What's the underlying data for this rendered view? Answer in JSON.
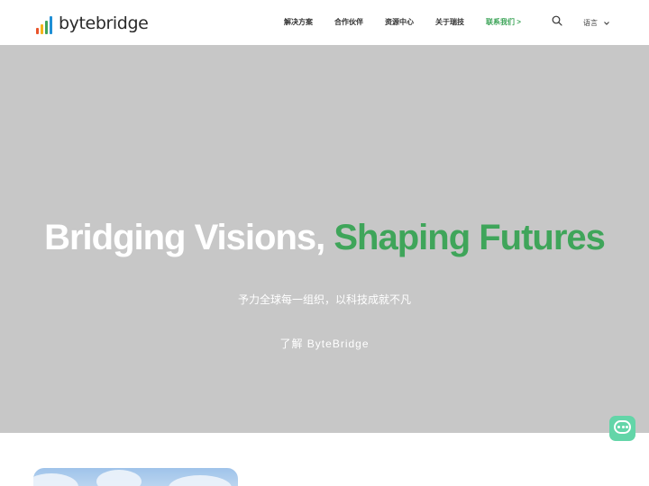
{
  "header": {
    "logo_text": "bytebridge",
    "logo_icon": "bar-chart-logo-icon",
    "nav": [
      {
        "label": "解决方案"
      },
      {
        "label": "合作伙伴"
      },
      {
        "label": "资源中心"
      },
      {
        "label": "关于瑞技"
      },
      {
        "label": "联系我们 >"
      }
    ],
    "search_icon": "search-icon",
    "language_label": "语言",
    "language_icon": "chevron-down-icon"
  },
  "hero": {
    "title_main": "Bridging Visions, ",
    "title_accent": "Shaping Futures",
    "subtitle": "予力全球每一组织，以科技成就不凡",
    "cta": "了解 ByteBridge"
  },
  "chat": {
    "icon": "chat-bubble-icon"
  },
  "colors": {
    "accent": "#3fa55a",
    "hero_bg": "#c7c7c7",
    "chat_bg": "#63d5a8",
    "logo_bars": [
      "#e9542b",
      "#f4b41a",
      "#3fa55a",
      "#1f8fd6"
    ]
  }
}
